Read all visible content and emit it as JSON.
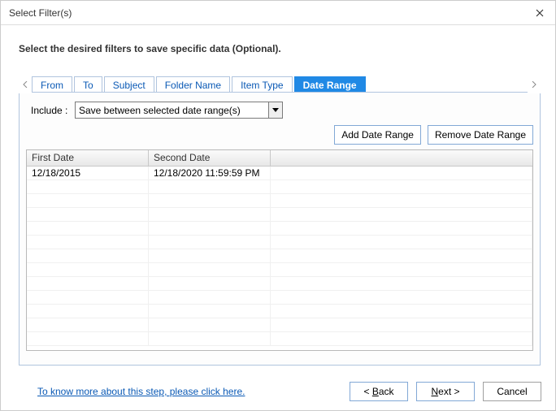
{
  "window": {
    "title": "Select Filter(s)"
  },
  "instruction": "Select the desired filters to save specific data (Optional).",
  "tabs": {
    "items": [
      {
        "label": "From"
      },
      {
        "label": "To"
      },
      {
        "label": "Subject"
      },
      {
        "label": "Folder Name"
      },
      {
        "label": "Item Type"
      },
      {
        "label": "Date Range"
      }
    ],
    "active_index": 5
  },
  "include": {
    "label": "Include :",
    "selected": "Save between selected date range(s)"
  },
  "buttons": {
    "add_range": "Add Date Range",
    "remove_range": "Remove Date Range"
  },
  "grid": {
    "headers": {
      "first": "First Date",
      "second": "Second Date"
    },
    "rows": [
      {
        "first": "12/18/2015",
        "second": "12/18/2020 11:59:59 PM"
      }
    ]
  },
  "help_link": "To know more about this step, please click here.",
  "footer": {
    "back": "< ",
    "back_u": "B",
    "back_rest": "ack",
    "next_u": "N",
    "next_rest": "ext >",
    "cancel": "Cancel"
  }
}
